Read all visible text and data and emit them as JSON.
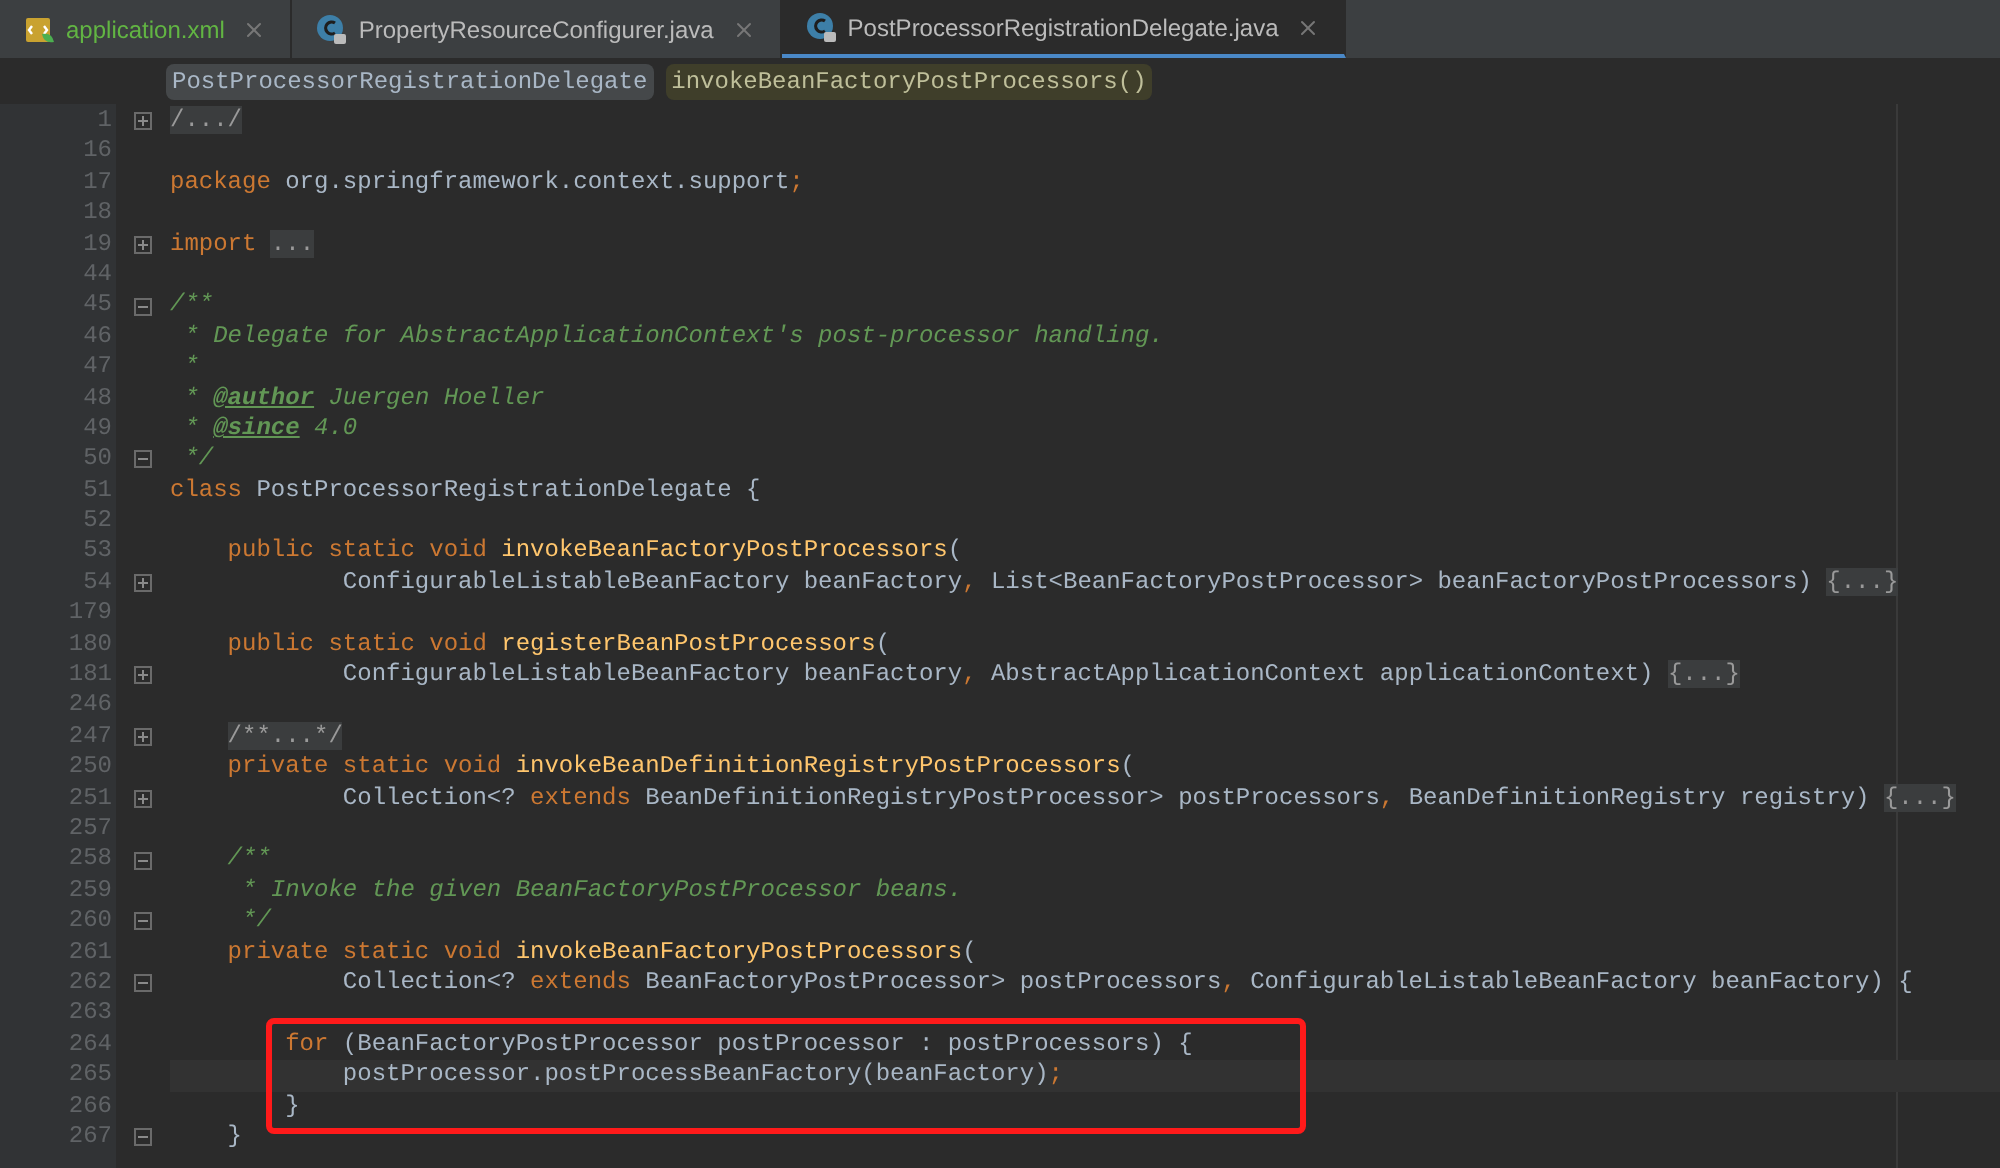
{
  "tabs": [
    {
      "label": "application.xml",
      "kind": "xml",
      "selected": false
    },
    {
      "label": "PropertyResourceConfigurer.java",
      "kind": "class",
      "selected": false
    },
    {
      "label": "PostProcessorRegistrationDelegate.java",
      "kind": "class",
      "selected": true
    }
  ],
  "breadcrumbs": [
    {
      "label": "PostProcessorRegistrationDelegate",
      "kind": "class"
    },
    {
      "label": "invokeBeanFactoryPostProcessors()",
      "kind": "method"
    }
  ],
  "lines": [
    {
      "number": "1",
      "collapsed": true,
      "tokens": [
        {
          "kind": "folded",
          "text": "/.../"
        }
      ]
    },
    {
      "number": "16"
    },
    {
      "number": "17",
      "tokens": [
        {
          "kind": "keyword",
          "text": "package "
        },
        {
          "kind": "plain",
          "text": "org.springframework.context.support"
        },
        {
          "kind": "keyword",
          "text": ";"
        }
      ]
    },
    {
      "number": "18"
    },
    {
      "number": "19",
      "collapsed": true,
      "tokens": [
        {
          "kind": "keyword",
          "text": "import "
        },
        {
          "kind": "folded",
          "text": "..."
        }
      ]
    },
    {
      "number": "44"
    },
    {
      "number": "45",
      "collapsed": false,
      "tokens": [
        {
          "kind": "comment",
          "text": "/**"
        }
      ]
    },
    {
      "number": "46",
      "tokens": [
        {
          "kind": "comment",
          "text": " * Delegate for AbstractApplicationContext's post-processor handling."
        }
      ]
    },
    {
      "number": "47",
      "tokens": [
        {
          "kind": "comment",
          "text": " *"
        }
      ]
    },
    {
      "number": "48",
      "tokens": [
        {
          "kind": "comment",
          "text": " * "
        },
        {
          "kind": "doctag",
          "text": "@author"
        },
        {
          "kind": "comment",
          "text": " Juergen Hoeller"
        }
      ]
    },
    {
      "number": "49",
      "tokens": [
        {
          "kind": "comment",
          "text": " * "
        },
        {
          "kind": "doctag",
          "text": "@since"
        },
        {
          "kind": "comment",
          "text": " 4.0"
        }
      ]
    },
    {
      "number": "50",
      "collapsed": false,
      "tokens": [
        {
          "kind": "comment",
          "text": " */"
        }
      ]
    },
    {
      "number": "51",
      "tokens": [
        {
          "kind": "keyword",
          "text": "class "
        },
        {
          "kind": "plain",
          "text": "PostProcessorRegistrationDelegate {"
        }
      ]
    },
    {
      "number": "52"
    },
    {
      "number": "53",
      "tokens": [
        {
          "kind": "keyword",
          "text": "    public static void "
        },
        {
          "kind": "method",
          "text": "invokeBeanFactoryPostProcessors"
        },
        {
          "kind": "plain",
          "text": "("
        }
      ]
    },
    {
      "number": "54",
      "collapsed": true,
      "tokens": [
        {
          "kind": "plain",
          "text": "            ConfigurableListableBeanFactory beanFactory"
        },
        {
          "kind": "keyword",
          "text": ", "
        },
        {
          "kind": "plain",
          "text": "List<BeanFactoryPostProcessor> beanFactoryPostProcessors) "
        },
        {
          "kind": "folded",
          "text": "{...}"
        }
      ]
    },
    {
      "number": "179"
    },
    {
      "number": "180",
      "tokens": [
        {
          "kind": "keyword",
          "text": "    public static void "
        },
        {
          "kind": "method",
          "text": "registerBeanPostProcessors"
        },
        {
          "kind": "plain",
          "text": "("
        }
      ]
    },
    {
      "number": "181",
      "collapsed": true,
      "tokens": [
        {
          "kind": "plain",
          "text": "            ConfigurableListableBeanFactory beanFactory"
        },
        {
          "kind": "keyword",
          "text": ", "
        },
        {
          "kind": "plain",
          "text": "AbstractApplicationContext applicationContext) "
        },
        {
          "kind": "folded",
          "text": "{...}"
        }
      ]
    },
    {
      "number": "246"
    },
    {
      "number": "247",
      "collapsed": true,
      "indented": true,
      "tokens": [
        {
          "kind": "folded",
          "text": "/**...*/"
        }
      ]
    },
    {
      "number": "250",
      "tokens": [
        {
          "kind": "keyword",
          "text": "    private static void "
        },
        {
          "kind": "method",
          "text": "invokeBeanDefinitionRegistryPostProcessors"
        },
        {
          "kind": "plain",
          "text": "("
        }
      ]
    },
    {
      "number": "251",
      "collapsed": true,
      "tokens": [
        {
          "kind": "plain",
          "text": "            Collection<? "
        },
        {
          "kind": "keyword",
          "text": "extends "
        },
        {
          "kind": "plain",
          "text": "BeanDefinitionRegistryPostProcessor> postProcessors"
        },
        {
          "kind": "keyword",
          "text": ", "
        },
        {
          "kind": "plain",
          "text": "BeanDefinitionRegistry registry) "
        },
        {
          "kind": "folded",
          "text": "{...}"
        }
      ]
    },
    {
      "number": "257"
    },
    {
      "number": "258",
      "collapsed": false,
      "tokens": [
        {
          "kind": "comment",
          "text": "    /**"
        }
      ]
    },
    {
      "number": "259",
      "tokens": [
        {
          "kind": "comment",
          "text": "     * Invoke the given BeanFactoryPostProcessor beans."
        }
      ]
    },
    {
      "number": "260",
      "collapsed": false,
      "tokens": [
        {
          "kind": "comment",
          "text": "     */"
        }
      ]
    },
    {
      "number": "261",
      "tokens": [
        {
          "kind": "keyword",
          "text": "    private static void "
        },
        {
          "kind": "method",
          "text": "invokeBeanFactoryPostProcessors"
        },
        {
          "kind": "plain",
          "text": "("
        }
      ]
    },
    {
      "number": "262",
      "collapsed": false,
      "tokens": [
        {
          "kind": "plain",
          "text": "            Collection<? "
        },
        {
          "kind": "keyword",
          "text": "extends "
        },
        {
          "kind": "plain",
          "text": "BeanFactoryPostProcessor> postProcessors"
        },
        {
          "kind": "keyword",
          "text": ", "
        },
        {
          "kind": "plain",
          "text": "ConfigurableListableBeanFactory beanFactory) {"
        }
      ]
    },
    {
      "number": "263"
    },
    {
      "number": "264",
      "boxed": true,
      "tokens": [
        {
          "kind": "keyword",
          "text": "        for "
        },
        {
          "kind": "plain",
          "text": "(BeanFactoryPostProcessor postProcessor : postProcessors) {"
        }
      ]
    },
    {
      "number": "265",
      "boxed": true,
      "current": true,
      "tokens": [
        {
          "kind": "plain",
          "text": "            postProcessor.postProcessBeanFactory(beanFactory)"
        },
        {
          "kind": "keyword",
          "text": ";"
        }
      ]
    },
    {
      "number": "266",
      "boxed": true,
      "tokens": [
        {
          "kind": "plain",
          "text": "        }"
        }
      ]
    },
    {
      "number": "267",
      "collapsed": false,
      "tokens": [
        {
          "kind": "plain",
          "text": "    }"
        }
      ]
    }
  ]
}
